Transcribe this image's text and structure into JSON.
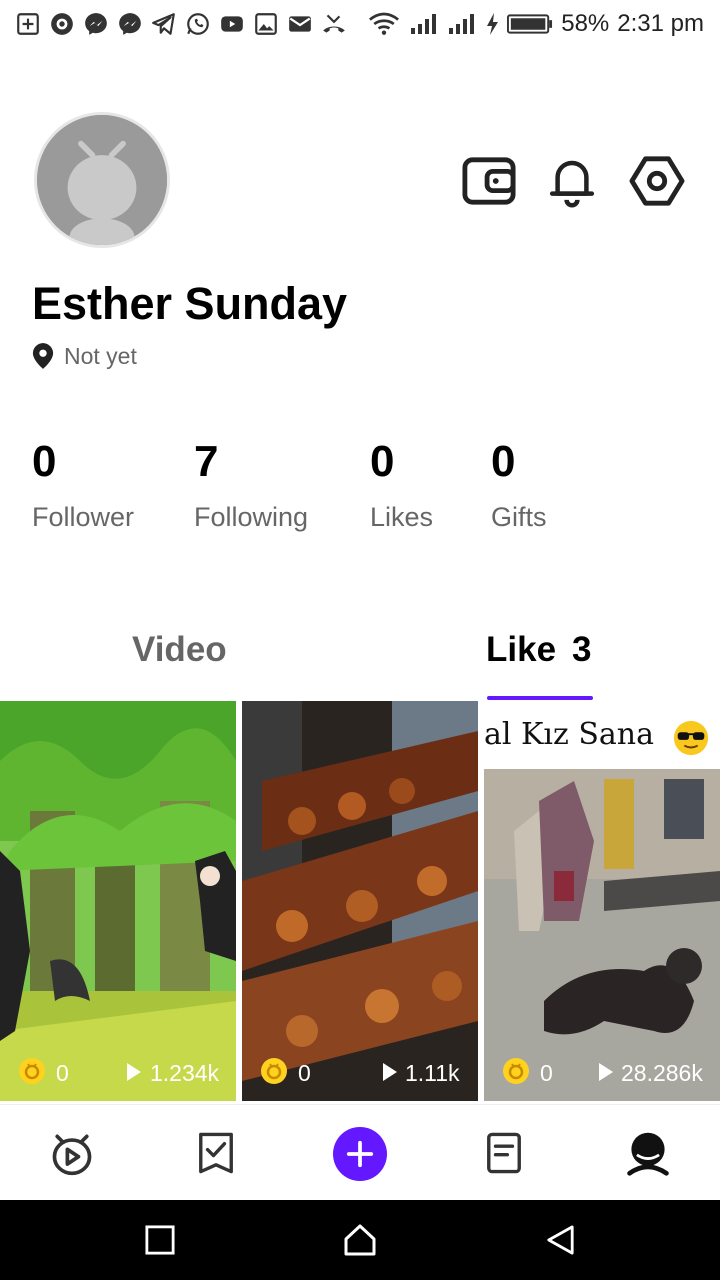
{
  "status_bar": {
    "battery": "58%",
    "time": "2:31 pm",
    "icons": [
      "add-box-icon",
      "app-icon",
      "messenger-icon",
      "messenger-icon",
      "telegram-icon",
      "whatsapp-icon",
      "youtube-icon",
      "image-icon",
      "mail-icon",
      "missed-call-icon",
      "wifi-icon",
      "signal-icon",
      "signal-icon",
      "charging-icon",
      "battery-icon"
    ]
  },
  "profile": {
    "name": "Esther Sunday",
    "location": "Not yet"
  },
  "header_actions": [
    "wallet-icon",
    "bell-icon",
    "settings-icon"
  ],
  "stats": [
    {
      "value": "0",
      "label": "Follower"
    },
    {
      "value": "7",
      "label": "Following"
    },
    {
      "value": "0",
      "label": "Likes"
    },
    {
      "value": "0",
      "label": "Gifts"
    }
  ],
  "tabs": {
    "video": "Video",
    "like": "Like",
    "like_count": "3",
    "active": "like",
    "accent": "#6418ff"
  },
  "videos": [
    {
      "coins": "0",
      "views": "1.234k",
      "overlay_text": ""
    },
    {
      "coins": "0",
      "views": "1.11k",
      "overlay_text": ""
    },
    {
      "coins": "0",
      "views": "28.286k",
      "overlay_text": "al Kız Sana"
    }
  ],
  "bottom_nav": [
    "home-video-icon",
    "tasks-icon",
    "add-icon",
    "feed-icon",
    "profile-icon"
  ],
  "colors": {
    "accent": "#6418ff",
    "coin": "#ffd21f"
  }
}
